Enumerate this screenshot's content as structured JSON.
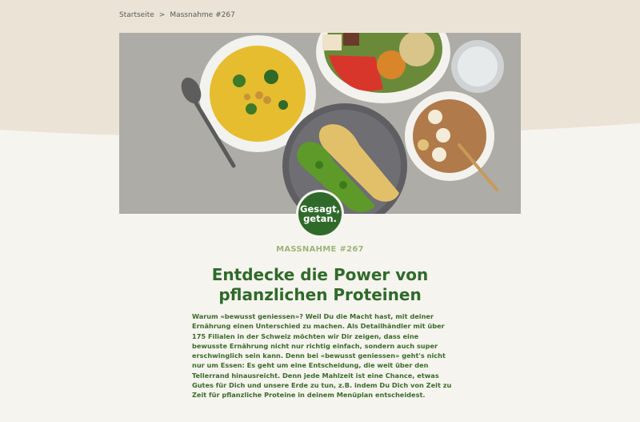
{
  "breadcrumb": {
    "home": "Startseite",
    "separator": ">",
    "current": "Massnahme #267"
  },
  "badge": {
    "line1": "Gesagt,",
    "line2": "getan."
  },
  "article": {
    "kicker": "MASSNAHME #267",
    "title": "Entdecke die Power von pflanzlichen Proteinen",
    "body": "Warum «bewusst geniessen»? Weil Du die Macht hast, mit deiner Ernährung einen Unterschied zu machen. Als Detailhändler mit über 175 Filialen in der Schweiz möchten wir Dir zeigen, dass eine bewusste Ernährung nicht nur richtig einfach, sondern auch super erschwinglich sein kann. Denn bei «bewusst geniessen» geht's nicht nur um Essen: Es geht um eine Entscheidung, die weit über den Tellerrand hinausreicht. Denn jede Mahlzeit ist eine Chance, etwas Gutes für Dich und unsere Erde zu tun, z.B. indem Du Dich von Zeit zu Zeit für pflanzliche Proteine in deinem Menüplan entscheidest."
  },
  "colors": {
    "brand_green": "#2f6a2a",
    "kicker_green": "#9cb57a",
    "top_background": "#ece3d7",
    "page_background": "#f6f4ee"
  }
}
